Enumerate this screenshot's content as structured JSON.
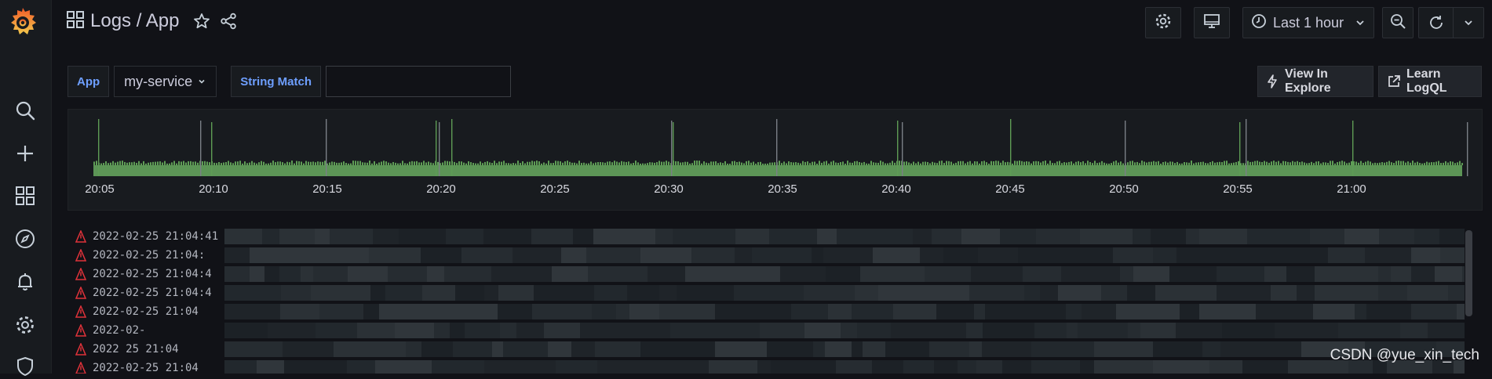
{
  "sidebar": {
    "items": [
      {
        "icon": "search-icon"
      },
      {
        "icon": "plus-icon"
      },
      {
        "icon": "dashboards-icon"
      },
      {
        "icon": "compass-icon"
      },
      {
        "icon": "bell-icon"
      },
      {
        "icon": "gear-icon"
      },
      {
        "icon": "shield-icon"
      }
    ]
  },
  "header": {
    "title": "Logs / App"
  },
  "toolbar": {
    "time_range": "Last 1 hour"
  },
  "variables": {
    "app_label": "App",
    "app_value": "my-service",
    "string_match_label": "String Match",
    "string_match_value": ""
  },
  "actions": {
    "view_in_explore": "View In Explore",
    "learn_logql": "Learn LogQL"
  },
  "chart_data": {
    "type": "bar",
    "x_ticks": [
      "20:05",
      "20:10",
      "20:15",
      "20:20",
      "20:25",
      "20:30",
      "20:35",
      "20:40",
      "20:45",
      "20:50",
      "20:55",
      "21:00"
    ],
    "series_color": "#73bf69"
  },
  "logs": {
    "rows": [
      {
        "ts": "2022-02-25 21:04:41"
      },
      {
        "ts": "2022-02-25 21:04:"
      },
      {
        "ts": "2022-02-25 21:04:4"
      },
      {
        "ts": "2022-02-25 21:04:4"
      },
      {
        "ts": "2022-02-25 21:04"
      },
      {
        "ts": "2022-02-"
      },
      {
        "ts": "2022 25 21:04"
      },
      {
        "ts": "2022-02-25 21:04"
      }
    ]
  },
  "watermark": "CSDN @yue_xin_tech"
}
